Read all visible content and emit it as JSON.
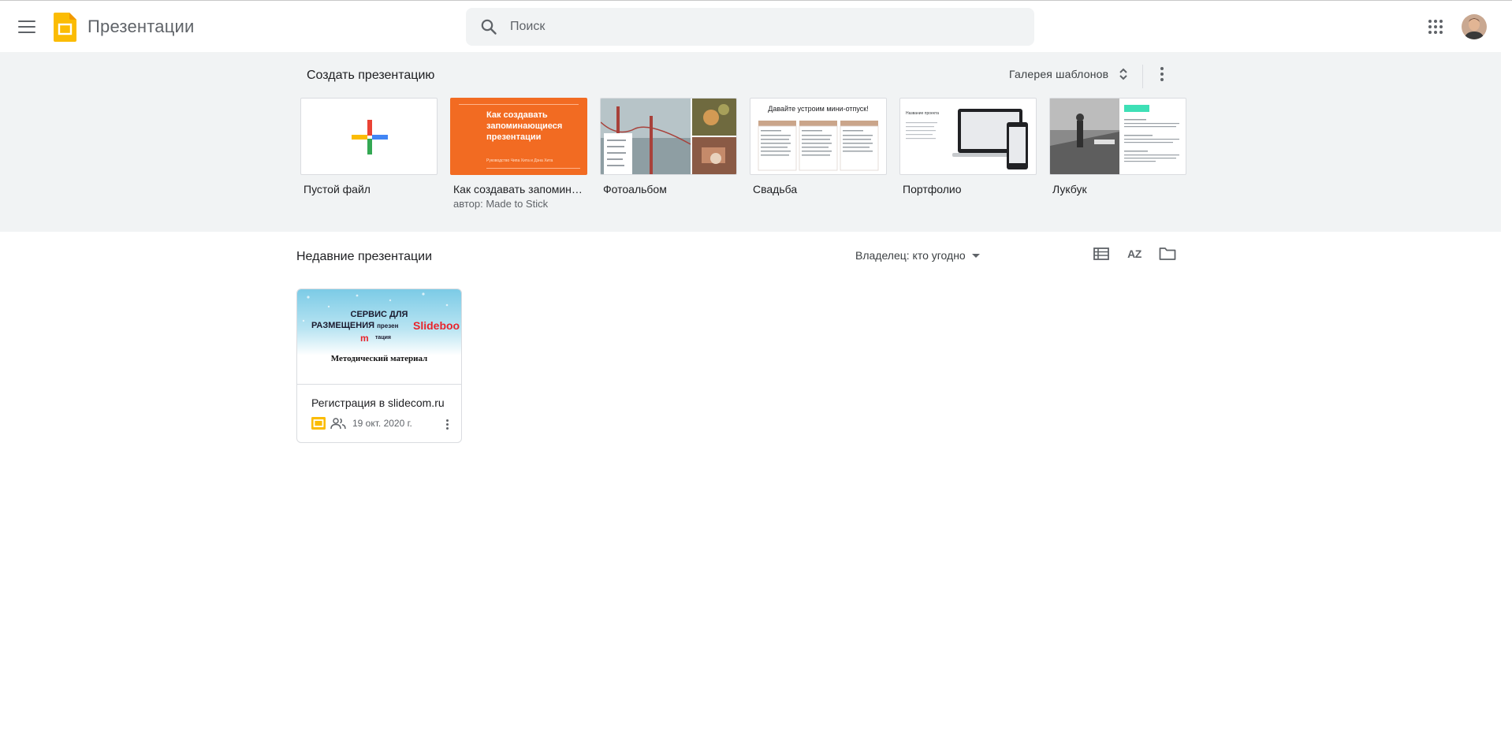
{
  "header": {
    "app_title": "Презентации",
    "search_placeholder": "Поиск",
    "colors": {
      "logo": "#fbbc04",
      "icon": "#5f6368"
    }
  },
  "templates": {
    "title": "Создать презентацию",
    "gallery_label": "Галерея шаблонов",
    "items": [
      {
        "name": "Пустой файл",
        "author": ""
      },
      {
        "name": "Как создавать запоминающиеся презентации",
        "author": "автор: Made to Stick",
        "thumb_title": "Как создавать запоминающиеся презентации",
        "thumb_sub": "Руководство Чипа Хита и Дэна Хита"
      },
      {
        "name": "Фотоальбом",
        "author": ""
      },
      {
        "name": "Свадьба",
        "author": "",
        "thumb_title": "Давайте устроим мини-отпуск!"
      },
      {
        "name": "Портфолио",
        "author": "",
        "thumb_title": "Название проекта"
      },
      {
        "name": "Лукбук",
        "author": ""
      }
    ]
  },
  "recent": {
    "title": "Недавние презентации",
    "owner_filter": "Владелец: кто угодно",
    "sort_label": "AZ",
    "documents": [
      {
        "name": "Регистрация в slidecom.ru",
        "date": "19 окт. 2020 г.",
        "thumb": {
          "line1": "СЕРВИС ДЛЯ",
          "line2": "РАЗМЕЩЕНИЯ",
          "line2_small": "презен",
          "brand": "Slideboo",
          "brand2": "m",
          "line3": "тация",
          "line4": "Методический материал"
        }
      }
    ]
  }
}
